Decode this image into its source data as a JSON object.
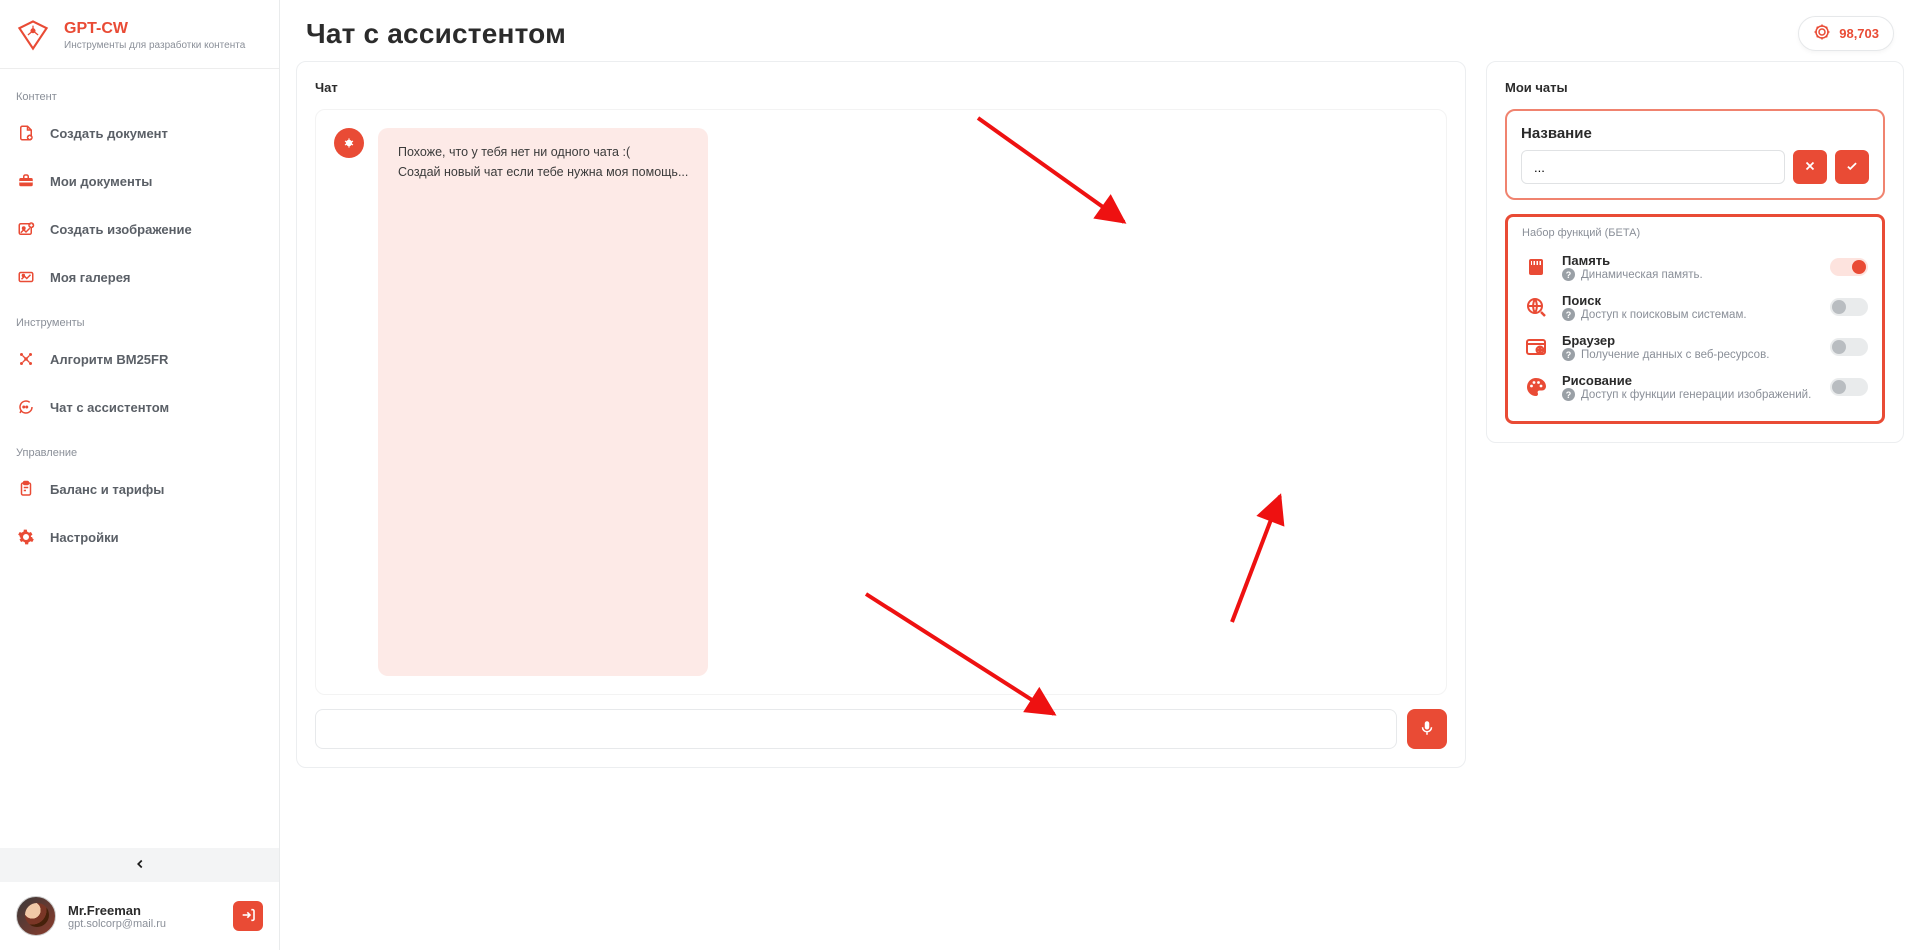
{
  "brand": {
    "title": "GPT-CW",
    "subtitle": "Инструменты для разработки контента"
  },
  "credits_value": "98,703",
  "page_title": "Чат с ассистентом",
  "sidebar": {
    "sections": [
      {
        "title": "Контент",
        "items": [
          {
            "label": "Создать документ",
            "icon": "file-plus"
          },
          {
            "label": "Мои документы",
            "icon": "briefcase"
          },
          {
            "label": "Создать изображение",
            "icon": "image-plus"
          },
          {
            "label": "Моя галерея",
            "icon": "gallery"
          }
        ]
      },
      {
        "title": "Инструменты",
        "items": [
          {
            "label": "Алгоритм BM25FR",
            "icon": "cluster"
          },
          {
            "label": "Чат с ассистентом",
            "icon": "chat"
          }
        ]
      },
      {
        "title": "Управление",
        "items": [
          {
            "label": "Баланс и тарифы",
            "icon": "clipboard"
          },
          {
            "label": "Настройки",
            "icon": "gear"
          }
        ]
      }
    ]
  },
  "user": {
    "name": "Mr.Freeman",
    "email": "gpt.solcorp@mail.ru"
  },
  "chat": {
    "card_title": "Чат",
    "bubble_line1": "Похоже, что у тебя нет ни одного чата :(",
    "bubble_line2": "Создай новый чат если тебе нужна моя помощь...",
    "input_placeholder": ""
  },
  "right": {
    "card_title": "Мои чаты",
    "name_label": "Название",
    "name_value": "...",
    "functions_title": "Набор функций (БЕТА)",
    "functions": [
      {
        "name": "Память",
        "desc": "Динамическая память.",
        "icon": "memory",
        "on": true
      },
      {
        "name": "Поиск",
        "desc": "Доступ к поисковым системам.",
        "icon": "search-globe",
        "on": false
      },
      {
        "name": "Браузер",
        "desc": "Получение данных с веб-ресурсов.",
        "icon": "browser",
        "on": false
      },
      {
        "name": "Рисование",
        "desc": "Доступ к функции генерации изображений.",
        "icon": "palette",
        "on": false
      }
    ]
  }
}
